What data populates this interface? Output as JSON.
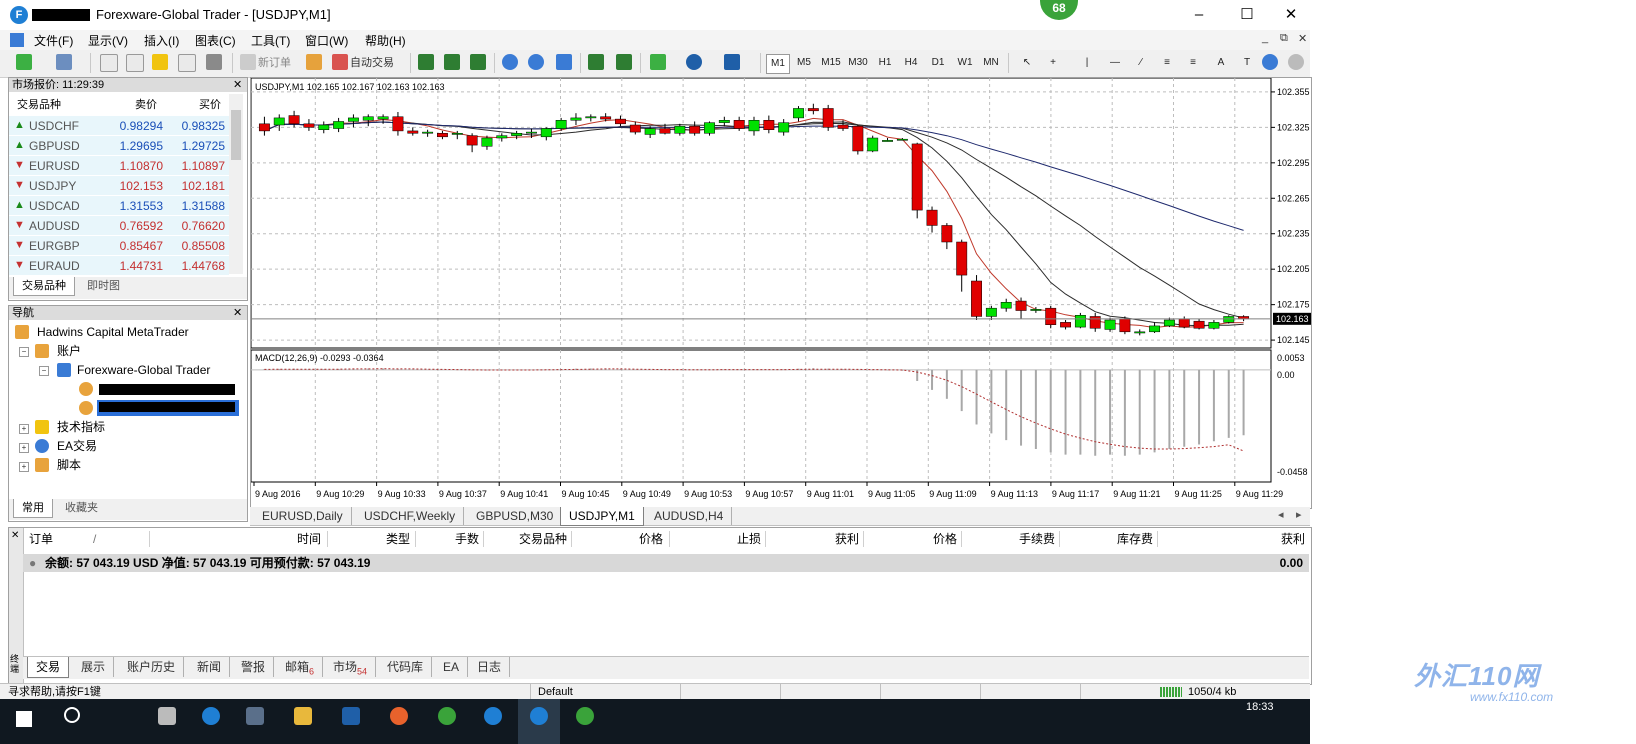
{
  "window": {
    "title": "Forexware-Global Trader - [USDJPY,M1]",
    "badge": "68",
    "minimize_icon": "minimize-icon",
    "maximize_icon": "maximize-icon",
    "close_icon": "close-icon"
  },
  "menu": {
    "items": [
      "文件(F)",
      "显示(V)",
      "插入(I)",
      "图表(C)",
      "工具(T)",
      "窗口(W)",
      "帮助(H)"
    ],
    "mdi_controls": [
      "_",
      "⧉",
      "✕"
    ]
  },
  "toolbar": {
    "new_order": "新订单",
    "auto_trading": "自动交易",
    "timeframes": [
      "M1",
      "M5",
      "M15",
      "M30",
      "H1",
      "H4",
      "D1",
      "W1",
      "MN"
    ],
    "active_timeframe": "M1"
  },
  "market_watch": {
    "title": "市场报价: 11:29:39",
    "columns": [
      "交易品种",
      "卖价",
      "买价"
    ],
    "rows": [
      {
        "symbol": "USDCHF",
        "bid": "0.98294",
        "ask": "0.98325",
        "dir": "up"
      },
      {
        "symbol": "GBPUSD",
        "bid": "1.29695",
        "ask": "1.29725",
        "dir": "up"
      },
      {
        "symbol": "EURUSD",
        "bid": "1.10870",
        "ask": "1.10897",
        "dir": "down"
      },
      {
        "symbol": "USDJPY",
        "bid": "102.153",
        "ask": "102.181",
        "dir": "down"
      },
      {
        "symbol": "USDCAD",
        "bid": "1.31553",
        "ask": "1.31588",
        "dir": "up"
      },
      {
        "symbol": "AUDUSD",
        "bid": "0.76592",
        "ask": "0.76620",
        "dir": "down"
      },
      {
        "symbol": "EURGBP",
        "bid": "0.85467",
        "ask": "0.85508",
        "dir": "down"
      },
      {
        "symbol": "EURAUD",
        "bid": "1.44731",
        "ask": "1.44768",
        "dir": "down"
      }
    ],
    "tabs": [
      "交易品种",
      "即时图"
    ]
  },
  "navigator": {
    "title": "导航",
    "root": "Hadwins Capital MetaTrader",
    "accounts": "账户",
    "server": "Forexware-Global Trader",
    "indicators": "技术指标",
    "experts": "EA交易",
    "scripts": "脚本",
    "tabs": [
      "常用",
      "收藏夹"
    ]
  },
  "chart": {
    "header": "USDJPY,M1  102.165 102.167 102.163 102.163",
    "price_labels": [
      "102.355",
      "102.325",
      "102.295",
      "102.265",
      "102.235",
      "102.205",
      "102.175",
      "102.145"
    ],
    "current_price": "102.163",
    "macd_label": "MACD(12,26,9) -0.0293 -0.0364",
    "macd_labels": [
      "0.0053",
      "0.00",
      "-0.0458"
    ],
    "time_labels": [
      "9 Aug 2016",
      "9 Aug 10:29",
      "9 Aug 10:33",
      "9 Aug 10:37",
      "9 Aug 10:41",
      "9 Aug 10:45",
      "9 Aug 10:49",
      "9 Aug 10:53",
      "9 Aug 10:57",
      "9 Aug 11:01",
      "9 Aug 11:05",
      "9 Aug 11:09",
      "9 Aug 11:13",
      "9 Aug 11:17",
      "9 Aug 11:21",
      "9 Aug 11:25",
      "9 Aug 11:29"
    ],
    "tabs": [
      "EURUSD,Daily",
      "USDCHF,Weekly",
      "GBPUSD,M30",
      "USDJPY,M1",
      "AUDUSD,H4"
    ],
    "active_tab": "USDJPY,M1",
    "bull_color": "#00e000",
    "bear_color": "#e00000"
  },
  "chart_data": {
    "type": "candlestick",
    "symbol": "USDJPY,M1",
    "ylim": [
      102.14,
      102.36
    ],
    "grid": true,
    "candles": [
      {
        "o": 102.328,
        "h": 102.334,
        "l": 102.318,
        "c": 102.322
      },
      {
        "o": 102.327,
        "h": 102.336,
        "l": 102.322,
        "c": 102.333
      },
      {
        "o": 102.335,
        "h": 102.339,
        "l": 102.325,
        "c": 102.328
      },
      {
        "o": 102.328,
        "h": 102.332,
        "l": 102.322,
        "c": 102.325
      },
      {
        "o": 102.323,
        "h": 102.33,
        "l": 102.32,
        "c": 102.327
      },
      {
        "o": 102.324,
        "h": 102.333,
        "l": 102.321,
        "c": 102.33
      },
      {
        "o": 102.33,
        "h": 102.336,
        "l": 102.325,
        "c": 102.333
      },
      {
        "o": 102.331,
        "h": 102.336,
        "l": 102.326,
        "c": 102.334
      },
      {
        "o": 102.332,
        "h": 102.336,
        "l": 102.328,
        "c": 102.334
      },
      {
        "o": 102.334,
        "h": 102.338,
        "l": 102.318,
        "c": 102.322
      },
      {
        "o": 102.322,
        "h": 102.325,
        "l": 102.318,
        "c": 102.32
      },
      {
        "o": 102.32,
        "h": 102.323,
        "l": 102.317,
        "c": 102.321
      },
      {
        "o": 102.32,
        "h": 102.322,
        "l": 102.315,
        "c": 102.317
      },
      {
        "o": 102.319,
        "h": 102.322,
        "l": 102.315,
        "c": 102.32
      },
      {
        "o": 102.318,
        "h": 102.32,
        "l": 102.304,
        "c": 102.31
      },
      {
        "o": 102.309,
        "h": 102.318,
        "l": 102.306,
        "c": 102.316
      },
      {
        "o": 102.316,
        "h": 102.32,
        "l": 102.313,
        "c": 102.318
      },
      {
        "o": 102.318,
        "h": 102.322,
        "l": 102.315,
        "c": 102.32
      },
      {
        "o": 102.32,
        "h": 102.324,
        "l": 102.316,
        "c": 102.321
      },
      {
        "o": 102.317,
        "h": 102.325,
        "l": 102.314,
        "c": 102.324
      },
      {
        "o": 102.324,
        "h": 102.333,
        "l": 102.322,
        "c": 102.331
      },
      {
        "o": 102.331,
        "h": 102.337,
        "l": 102.327,
        "c": 102.333
      },
      {
        "o": 102.333,
        "h": 102.336,
        "l": 102.33,
        "c": 102.334
      },
      {
        "o": 102.334,
        "h": 102.337,
        "l": 102.33,
        "c": 102.332
      },
      {
        "o": 102.332,
        "h": 102.335,
        "l": 102.326,
        "c": 102.328
      },
      {
        "o": 102.327,
        "h": 102.33,
        "l": 102.319,
        "c": 102.321
      },
      {
        "o": 102.319,
        "h": 102.326,
        "l": 102.316,
        "c": 102.324
      },
      {
        "o": 102.324,
        "h": 102.328,
        "l": 102.319,
        "c": 102.32
      },
      {
        "o": 102.32,
        "h": 102.328,
        "l": 102.318,
        "c": 102.326
      },
      {
        "o": 102.326,
        "h": 102.33,
        "l": 102.318,
        "c": 102.32
      },
      {
        "o": 102.32,
        "h": 102.33,
        "l": 102.318,
        "c": 102.329
      },
      {
        "o": 102.329,
        "h": 102.334,
        "l": 102.326,
        "c": 102.331
      },
      {
        "o": 102.331,
        "h": 102.334,
        "l": 102.322,
        "c": 102.324
      },
      {
        "o": 102.322,
        "h": 102.334,
        "l": 102.318,
        "c": 102.331
      },
      {
        "o": 102.331,
        "h": 102.335,
        "l": 102.32,
        "c": 102.323
      },
      {
        "o": 102.321,
        "h": 102.332,
        "l": 102.318,
        "c": 102.329
      },
      {
        "o": 102.333,
        "h": 102.343,
        "l": 102.33,
        "c": 102.341
      },
      {
        "o": 102.341,
        "h": 102.345,
        "l": 102.336,
        "c": 102.339
      },
      {
        "o": 102.341,
        "h": 102.344,
        "l": 102.322,
        "c": 102.325
      },
      {
        "o": 102.327,
        "h": 102.331,
        "l": 102.322,
        "c": 102.324
      },
      {
        "o": 102.326,
        "h": 102.327,
        "l": 102.302,
        "c": 102.305
      },
      {
        "o": 102.305,
        "h": 102.318,
        "l": 102.304,
        "c": 102.316
      },
      {
        "o": 102.313,
        "h": 102.316,
        "l": 102.313,
        "c": 102.314
      },
      {
        "o": 102.314,
        "h": 102.316,
        "l": 102.314,
        "c": 102.315
      },
      {
        "o": 102.311,
        "h": 102.312,
        "l": 102.248,
        "c": 102.255
      },
      {
        "o": 102.255,
        "h": 102.258,
        "l": 102.236,
        "c": 102.242
      },
      {
        "o": 102.242,
        "h": 102.244,
        "l": 102.222,
        "c": 102.228
      },
      {
        "o": 102.228,
        "h": 102.23,
        "l": 102.186,
        "c": 102.2
      },
      {
        "o": 102.195,
        "h": 102.2,
        "l": 102.162,
        "c": 102.165
      },
      {
        "o": 102.165,
        "h": 102.174,
        "l": 102.162,
        "c": 102.172
      },
      {
        "o": 102.172,
        "h": 102.18,
        "l": 102.169,
        "c": 102.177
      },
      {
        "o": 102.178,
        "h": 102.181,
        "l": 102.163,
        "c": 102.17
      },
      {
        "o": 102.17,
        "h": 102.173,
        "l": 102.168,
        "c": 102.171
      },
      {
        "o": 102.172,
        "h": 102.174,
        "l": 102.155,
        "c": 102.158
      },
      {
        "o": 102.16,
        "h": 102.162,
        "l": 102.154,
        "c": 102.156
      },
      {
        "o": 102.156,
        "h": 102.168,
        "l": 102.155,
        "c": 102.166
      },
      {
        "o": 102.165,
        "h": 102.168,
        "l": 102.152,
        "c": 102.155
      },
      {
        "o": 102.154,
        "h": 102.164,
        "l": 102.152,
        "c": 102.162
      },
      {
        "o": 102.163,
        "h": 102.165,
        "l": 102.15,
        "c": 102.152
      },
      {
        "o": 102.151,
        "h": 102.154,
        "l": 102.149,
        "c": 102.152
      },
      {
        "o": 102.152,
        "h": 102.16,
        "l": 102.151,
        "c": 102.157
      },
      {
        "o": 102.157,
        "h": 102.164,
        "l": 102.156,
        "c": 102.162
      },
      {
        "o": 102.163,
        "h": 102.165,
        "l": 102.155,
        "c": 102.156
      },
      {
        "o": 102.161,
        "h": 102.163,
        "l": 102.154,
        "c": 102.155
      },
      {
        "o": 102.155,
        "h": 102.162,
        "l": 102.154,
        "c": 102.16
      },
      {
        "o": 102.16,
        "h": 102.166,
        "l": 102.159,
        "c": 102.165
      },
      {
        "o": 102.165,
        "h": 102.166,
        "l": 102.161,
        "c": 102.163
      }
    ],
    "macd_ylim": [
      -0.0458,
      0.0053
    ],
    "macd": [
      0.0003,
      0.0004,
      0.0005,
      0.0004,
      0.0003,
      0.0004,
      0.0005,
      0.0006,
      0.0006,
      0.0003,
      0.0002,
      0.0001,
      0.0,
      -0.0001,
      -0.0003,
      -0.0003,
      -0.0002,
      -0.0001,
      0.0,
      0.0001,
      0.0003,
      0.0005,
      0.0006,
      0.0006,
      0.0004,
      0.0001,
      0.0,
      -0.0001,
      0.0,
      -0.0001,
      0.0,
      0.0002,
      0.0001,
      0.0002,
      0.0001,
      0.0002,
      0.0005,
      0.0007,
      0.0005,
      0.0003,
      -0.0001,
      -0.0002,
      -0.0003,
      -0.0004,
      -0.005,
      -0.009,
      -0.013,
      -0.0185,
      -0.0245,
      -0.0285,
      -0.0315,
      -0.034,
      -0.0355,
      -0.037,
      -0.038,
      -0.038,
      -0.0385,
      -0.038,
      -0.0385,
      -0.038,
      -0.037,
      -0.0355,
      -0.0345,
      -0.0335,
      -0.032,
      -0.0305,
      -0.0293
    ],
    "signal": [
      0.0002,
      0.0003,
      0.0003,
      0.0003,
      0.0003,
      0.0003,
      0.0004,
      0.0004,
      0.0005,
      0.0004,
      0.0004,
      0.0003,
      0.0002,
      0.0001,
      0.0,
      -0.0001,
      -0.0001,
      -0.0001,
      -0.0001,
      0.0,
      0.0001,
      0.0002,
      0.0003,
      0.0004,
      0.0004,
      0.0003,
      0.0002,
      0.0001,
      0.0001,
      0.0,
      0.0,
      0.0001,
      0.0001,
      0.0001,
      0.0001,
      0.0001,
      0.0002,
      0.0003,
      0.0003,
      0.0003,
      0.0002,
      0.0001,
      0.0,
      -0.0001,
      -0.001,
      -0.0026,
      -0.0047,
      -0.0075,
      -0.0109,
      -0.0144,
      -0.0178,
      -0.021,
      -0.0239,
      -0.0265,
      -0.0288,
      -0.0306,
      -0.0322,
      -0.0334,
      -0.0344,
      -0.0351,
      -0.0355,
      -0.0355,
      -0.0353,
      -0.0349,
      -0.0344,
      -0.0336,
      -0.0364
    ]
  },
  "terminal": {
    "columns": [
      "订单",
      "/",
      "时间",
      "类型",
      "手数",
      "交易品种",
      "价格",
      "止损",
      "获利",
      "价格",
      "手续费",
      "库存费",
      "获利"
    ],
    "balance_text": "余额: 57 043.19 USD  净值: 57 043.19  可用预付款: 57 043.19",
    "balance_profit": "0.00",
    "tabs": [
      "交易",
      "展示",
      "账户历史",
      "新闻",
      "警报",
      "邮箱",
      "市场",
      "代码库",
      "EA",
      "日志"
    ],
    "tab_badges": {
      "邮箱": "6",
      "市场": "54"
    },
    "side_label": "终端"
  },
  "status": {
    "help": "寻求帮助,请按F1键",
    "profile": "Default",
    "traffic": "1050/4 kb"
  },
  "taskbar": {
    "clock": "18:33"
  },
  "watermark": {
    "brand": "外汇110网",
    "url": "www.fx110.com"
  }
}
